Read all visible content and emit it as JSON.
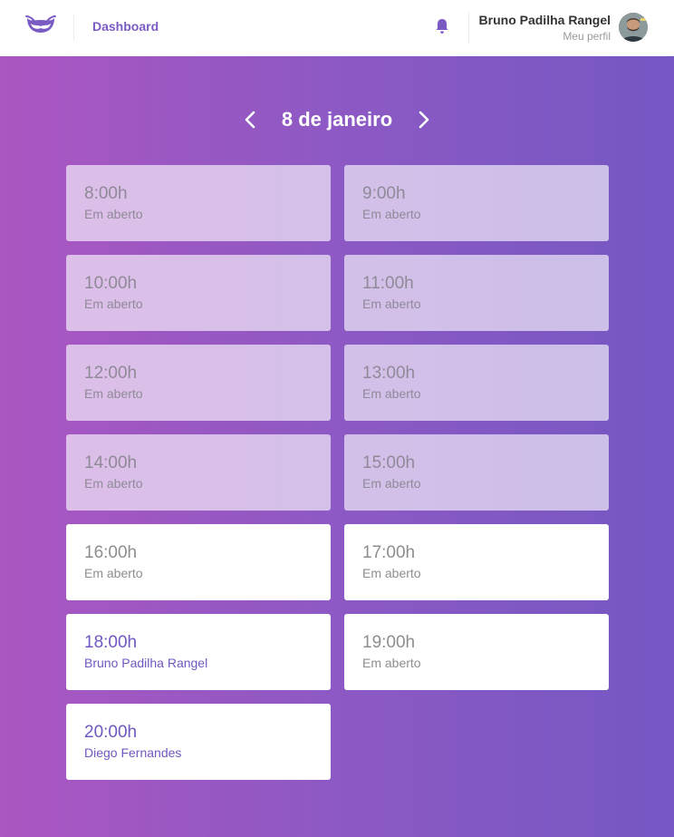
{
  "header": {
    "nav_label": "Dashboard",
    "user_name": "Bruno Padilha Rangel",
    "profile_link": "Meu perfil",
    "accent": "#7a5bc4"
  },
  "schedule": {
    "date_label": "8 de janeiro",
    "slots": [
      {
        "time": "8:00h",
        "status": "Em aberto",
        "state": "past"
      },
      {
        "time": "9:00h",
        "status": "Em aberto",
        "state": "past"
      },
      {
        "time": "10:00h",
        "status": "Em aberto",
        "state": "past"
      },
      {
        "time": "11:00h",
        "status": "Em aberto",
        "state": "past"
      },
      {
        "time": "12:00h",
        "status": "Em aberto",
        "state": "past"
      },
      {
        "time": "13:00h",
        "status": "Em aberto",
        "state": "past"
      },
      {
        "time": "14:00h",
        "status": "Em aberto",
        "state": "past"
      },
      {
        "time": "15:00h",
        "status": "Em aberto",
        "state": "past"
      },
      {
        "time": "16:00h",
        "status": "Em aberto",
        "state": "open"
      },
      {
        "time": "17:00h",
        "status": "Em aberto",
        "state": "open"
      },
      {
        "time": "18:00h",
        "status": "Bruno Padilha Rangel",
        "state": "booked"
      },
      {
        "time": "19:00h",
        "status": "Em aberto",
        "state": "open"
      },
      {
        "time": "20:00h",
        "status": "Diego Fernandes",
        "state": "booked"
      }
    ]
  }
}
